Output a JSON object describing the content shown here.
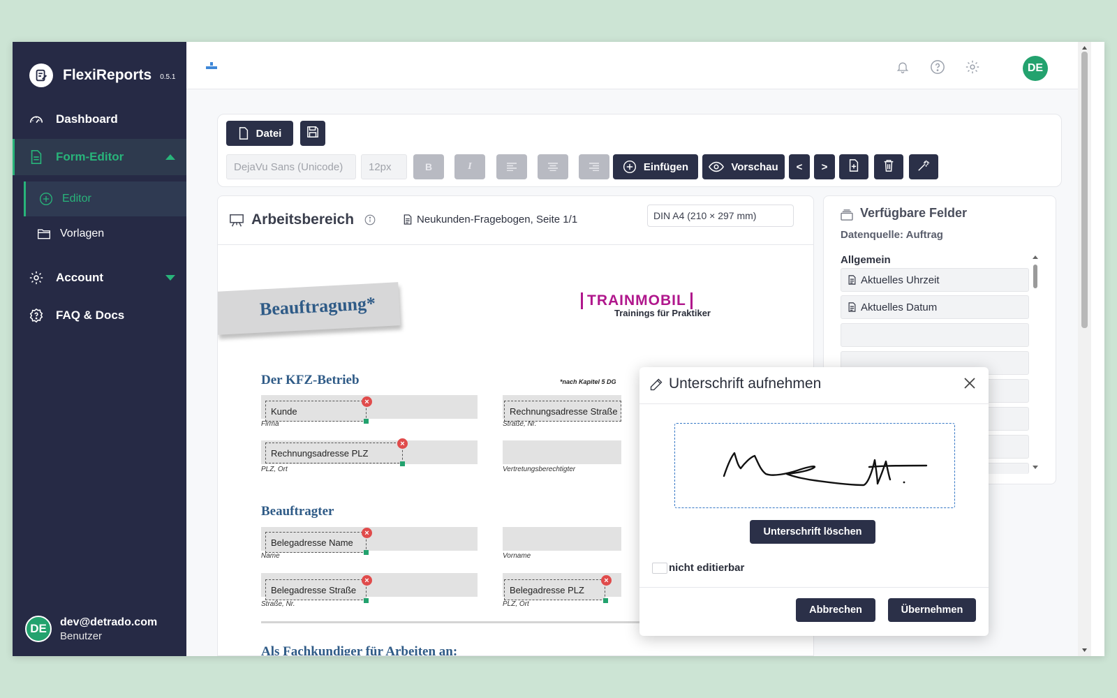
{
  "app": {
    "name": "FlexiReports",
    "version": "0.5.1"
  },
  "sidebar": {
    "items": [
      {
        "label": "Dashboard"
      },
      {
        "label": "Form-Editor"
      },
      {
        "label": "Account"
      },
      {
        "label": "FAQ & Docs"
      }
    ],
    "subitems": [
      {
        "label": "Editor"
      },
      {
        "label": "Vorlagen"
      }
    ],
    "user": {
      "initials": "DE",
      "email": "dev@detrado.com",
      "role": "Benutzer"
    }
  },
  "topbar": {
    "avatar": "DE"
  },
  "toolbar": {
    "file_label": "Datei",
    "font_family": "DejaVu Sans (Unicode)",
    "font_size": "12px",
    "bold": "B",
    "italic": "I",
    "insert_label": "Einfügen",
    "preview_label": "Vorschau",
    "prev": "<",
    "next": ">"
  },
  "workspace": {
    "title": "Arbeitsbereich",
    "document": "Neukunden-Fragebogen, Seite 1/1",
    "page_format": "DIN A4 (210 × 297 mm)",
    "form": {
      "banner": "Beauftragung*",
      "logo_line1": "TRAINMOBIL",
      "logo_line2": "Trainings für Praktiker",
      "note": "*nach Kapitel 5 DG",
      "section1": "Der KFZ-Betrieb",
      "section2": "Beauftragter",
      "section3": "Als Fachkundiger für Arbeiten an:",
      "fields": {
        "kunde": "Kunde",
        "rech_strasse": "Rechnungsadresse Straße",
        "rech_plz": "Rechnungsadresse PLZ",
        "beleg_name": "Belegadresse Name",
        "beleg_strasse": "Belegadresse Straße",
        "beleg_plz": "Belegadresse PLZ"
      },
      "captions": {
        "firma": "Firma",
        "strasse_nr": "Straße, Nr.",
        "plz_ort": "PLZ, Ort",
        "vertretung": "Vertretungsberechtigter",
        "name": "Name",
        "vorname": "Vorname",
        "strasse_nr2": "Straße, Nr.",
        "plz_ort2": "PLZ, Ort"
      }
    }
  },
  "fields_panel": {
    "title": "Verfügbare Felder",
    "source": "Datenquelle: Auftrag",
    "group": "Allgemein",
    "items": [
      {
        "label": "Aktuelles Uhrzeit"
      },
      {
        "label": "Aktuelles Datum"
      }
    ]
  },
  "modal": {
    "title": "Unterschrift aufnehmen",
    "clear_label": "Unterschrift löschen",
    "checkbox_label": "nicht editierbar",
    "cancel_label": "Abbrechen",
    "apply_label": "Übernehmen"
  },
  "colors": {
    "sidebar_bg": "#262a45",
    "accent_green": "#28b47a",
    "button_dark": "#2b3048",
    "form_blue": "#2f5b87",
    "logo_magenta": "#b0178c",
    "delete_red": "#e04b4b"
  }
}
